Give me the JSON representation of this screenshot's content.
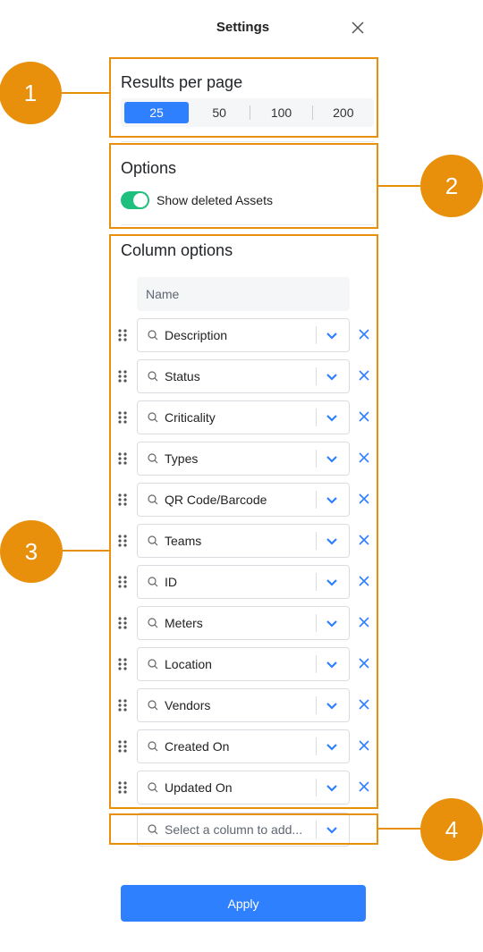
{
  "header": {
    "title": "Settings",
    "close_icon": "close-icon"
  },
  "results_per_page": {
    "title": "Results per page",
    "options": [
      "25",
      "50",
      "100",
      "200"
    ],
    "selected": "25"
  },
  "options": {
    "title": "Options",
    "toggle_label": "Show deleted Assets",
    "toggle_on": true
  },
  "column_options": {
    "title": "Column options",
    "fixed_column": "Name",
    "columns": [
      "Description",
      "Status",
      "Criticality",
      "Types",
      "QR Code/Barcode",
      "Teams",
      "ID",
      "Meters",
      "Location",
      "Vendors",
      "Created On",
      "Updated On"
    ],
    "add_placeholder": "Select a column to add..."
  },
  "apply_label": "Apply",
  "annotations": [
    "1",
    "2",
    "3",
    "4"
  ],
  "colors": {
    "accent": "#2f80ff",
    "toggle": "#1fbf7e",
    "annotation": "#e8900c"
  }
}
